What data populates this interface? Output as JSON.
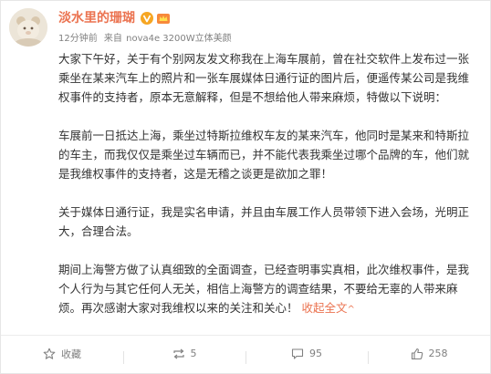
{
  "post": {
    "author": "淡水里的珊瑚",
    "time": "12分钟前",
    "source_prefix": "来自",
    "source": "nova4e 3200W立体美颜",
    "paragraphs": [
      "大家下午好，关于有个别网友发文称我在上海车展前，曾在社交软件上发布过一张乘坐在某来汽车上的照片和一张车展媒体日通行证的图片后，便遥传某公司是我维权事件的支持者，原本无意解释，但是不想给他人带来麻烦，特做以下说明：",
      "车展前一日抵达上海，乘坐过特斯拉维权车友的某来汽车，他同时是某来和特斯拉的车主，而我仅仅是乘坐过车辆而已，并不能代表我乘坐过哪个品牌的车，他们就是我维权事件的支持者，这是无稽之谈更是欲加之罪！",
      "关于媒体日通行证，我是实名申请，并且由车展工作人员带领下进入会场，光明正大，合理合法。",
      "期间上海警方做了认真细致的全面调查，已经查明事实真相，此次维权事件，是我个人行为与其它任何人无关，相信上海警方的调查结果，不要给无辜的人带来麻烦。再次感谢大家对我维权以来的关注和关心！"
    ],
    "collapse_label": "收起全文",
    "collapse_arrow": "^"
  },
  "actions": {
    "favorite_label": "收藏",
    "repost_count": "5",
    "comment_count": "95",
    "like_count": "258"
  },
  "icons": {
    "verified": "verified-v-icon",
    "member": "member-crown-icon",
    "favorite": "star-icon",
    "repost": "repost-icon",
    "comment": "comment-icon",
    "like": "thumbs-up-icon"
  },
  "colors": {
    "accent": "#eb7350",
    "verified": "#f6a623",
    "meta_text": "#808080",
    "body_text": "#333333"
  }
}
